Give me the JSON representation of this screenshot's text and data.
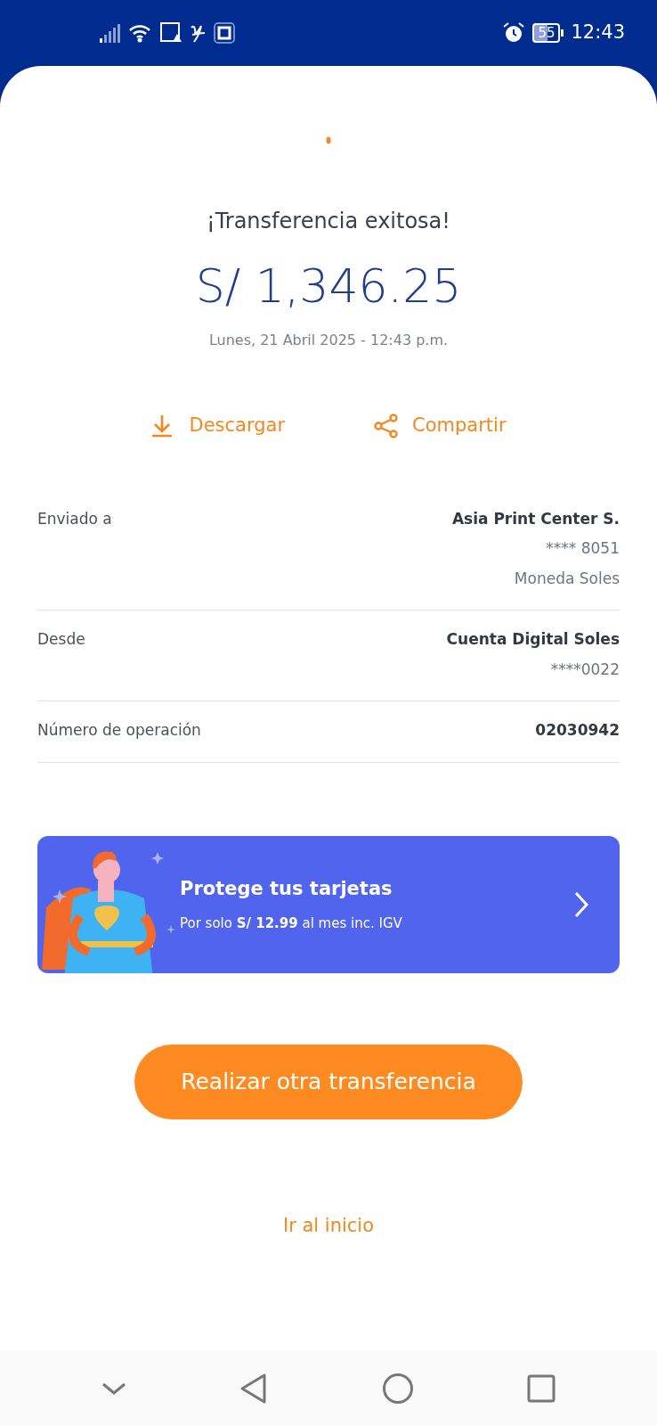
{
  "status_bar": {
    "battery": "55",
    "time": "12:43"
  },
  "receipt": {
    "title": "¡Transferencia exitosa!",
    "amount": "S/ 1,346.25",
    "date": "Lunes, 21 Abril 2025 - 12:43 p.m.",
    "actions": [
      {
        "kind": "download",
        "label": "Descargar"
      },
      {
        "kind": "share",
        "label": "Compartir"
      }
    ],
    "details": [
      {
        "label": "Enviado a",
        "values": [
          "Asia Print Center S.",
          "**** 8051",
          "Moneda Soles"
        ]
      },
      {
        "label": "Desde",
        "values": [
          "Cuenta Digital Soles",
          "****0022"
        ]
      },
      {
        "label": "Número de operación",
        "values": [
          "02030942"
        ]
      }
    ]
  },
  "banner": {
    "title": "Protege tus tarjetas",
    "text": "Por solo **S/ 12.99** al mes inc. IGV"
  },
  "primary_button": "Realizar otra transferencia",
  "home_link": "Ir al inicio"
}
